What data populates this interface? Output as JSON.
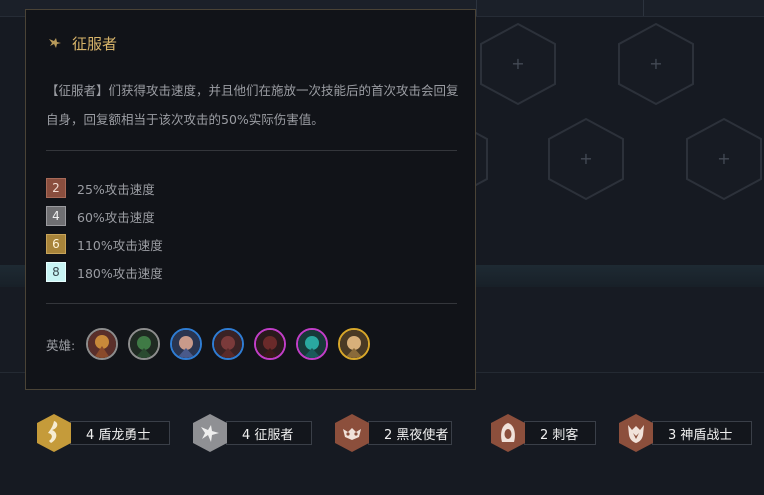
{
  "tooltip": {
    "title": "征服者",
    "icon": "conqueror-icon",
    "description": "【征服者】们获得攻击速度，并且他们在施放一次技能后的首次攻击会回复自身，回复额相当于该次攻击的50%实际伤害值。",
    "tiers": [
      {
        "count": "2",
        "text": "25%攻击速度",
        "color": "#8a4e3e"
      },
      {
        "count": "4",
        "text": "60%攻击速度",
        "color": "#6f6f72"
      },
      {
        "count": "6",
        "text": "110%攻击速度",
        "color": "#a8843a"
      },
      {
        "count": "8",
        "text": "180%攻击速度",
        "color": "#c8f4f4"
      }
    ],
    "heroes_label": "英雄:",
    "heroes": [
      {
        "name": "hero-1",
        "border": "#8d8d8d"
      },
      {
        "name": "hero-2",
        "border": "#8d8d8d"
      },
      {
        "name": "hero-3",
        "border": "#2f7dd4"
      },
      {
        "name": "hero-4",
        "border": "#2f7dd4"
      },
      {
        "name": "hero-5",
        "border": "#c23ec8"
      },
      {
        "name": "hero-6",
        "border": "#c23ec8"
      },
      {
        "name": "hero-7",
        "border": "#d8a72a"
      }
    ]
  },
  "traits": [
    {
      "label": "4 盾龙勇士",
      "color": "#c59b3a",
      "icon": "dragon-icon"
    },
    {
      "label": "4 征服者",
      "color": "#8f9094",
      "icon": "conqueror-icon"
    },
    {
      "label": "2 黑夜使者",
      "color": "#8c4f3c",
      "icon": "mask-icon"
    },
    {
      "label": "2 刺客",
      "color": "#8c4f3c",
      "icon": "hood-icon"
    },
    {
      "label": "3 神盾战士",
      "color": "#8c4f3c",
      "icon": "shield-warrior-icon"
    }
  ],
  "board": {
    "empty_slot_symbol": "+"
  }
}
